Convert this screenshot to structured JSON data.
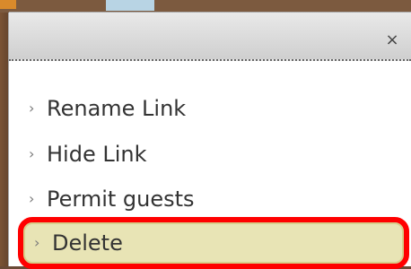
{
  "menu": {
    "close_label": "×",
    "items": [
      {
        "label": "Rename Link",
        "icon": "chevron-right"
      },
      {
        "label": "Hide Link",
        "icon": "chevron-right"
      },
      {
        "label": "Permit guests",
        "icon": "chevron-right"
      },
      {
        "label": "Delete",
        "icon": "chevron-right"
      }
    ]
  }
}
